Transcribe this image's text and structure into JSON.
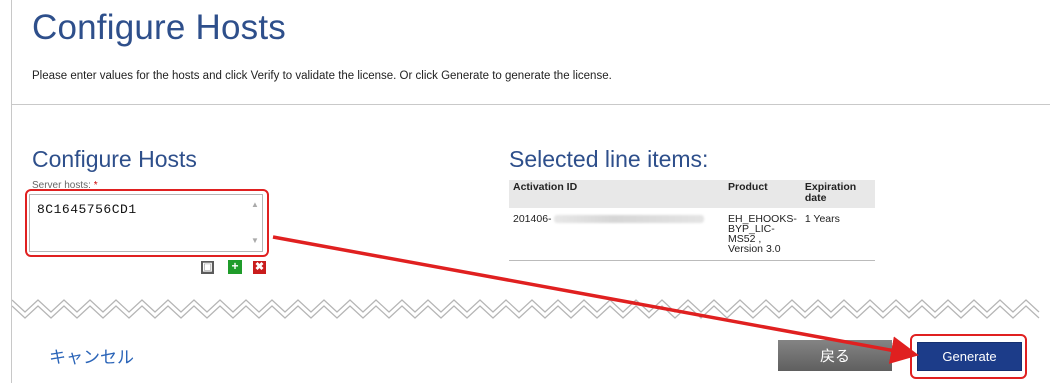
{
  "page": {
    "title": "Configure Hosts",
    "instructions": "Please enter values for the hosts and click Verify to validate the license. Or click Generate to generate the license."
  },
  "configure": {
    "title": "Configure Hosts",
    "server_hosts_label": "Server hosts:",
    "required_mark": "*",
    "server_hosts_value": "8C1645756CD1"
  },
  "line_items": {
    "title": "Selected line items:",
    "columns": [
      "Activation ID",
      "Product",
      "Expiration date"
    ],
    "rows": [
      {
        "activation_id": "201406-",
        "product": "EH_EHOOKS-BYP_LIC-MS52 , Version 3.0",
        "expiration": "1 Years"
      }
    ]
  },
  "footer": {
    "cancel_label": "キャンセル",
    "back_label": "戻る",
    "generate_label": "Generate"
  },
  "colors": {
    "title_blue": "#2e4f8b",
    "generate_blue": "#1c3c89",
    "annotation_red": "#e02020"
  },
  "icons": [
    "copy-icon",
    "add-icon",
    "remove-icon",
    "annotation-arrow"
  ]
}
